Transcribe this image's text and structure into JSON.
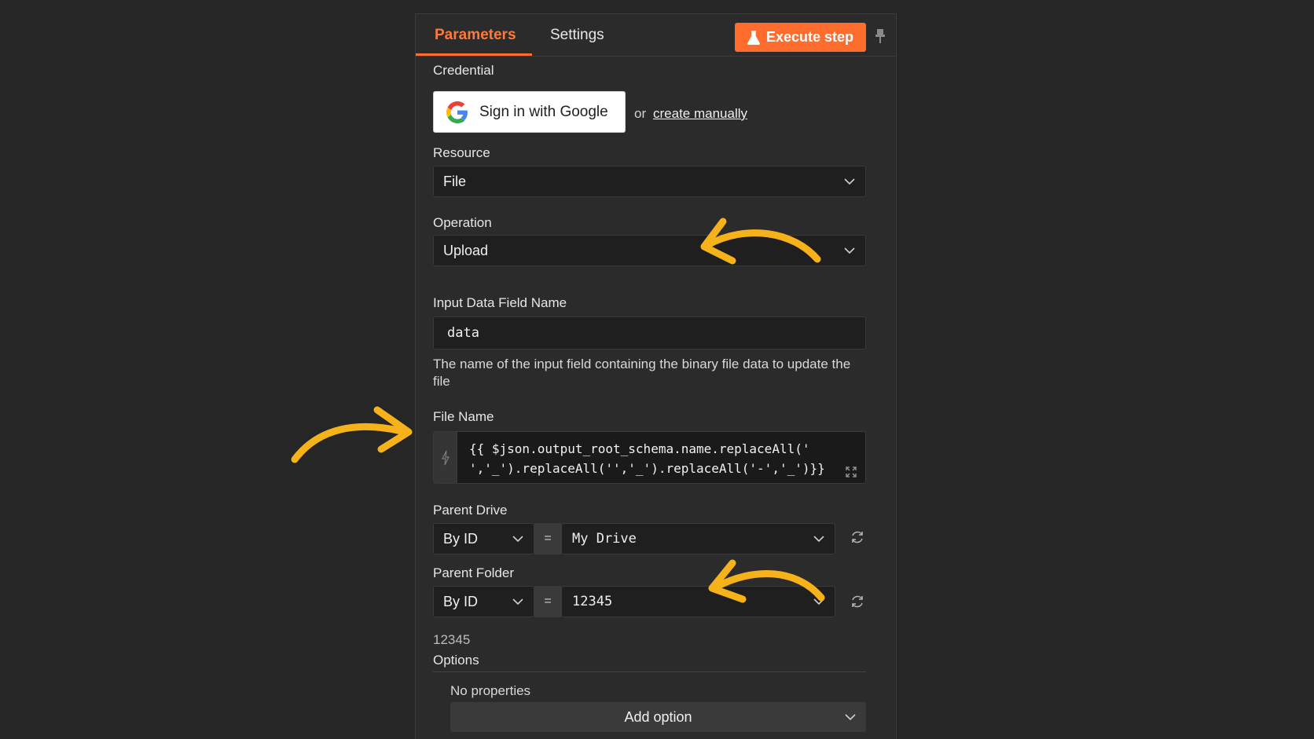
{
  "tabs": [
    {
      "label": "Parameters",
      "active": true
    },
    {
      "label": "Settings",
      "active": false
    }
  ],
  "toolbar": {
    "execute_label": "Execute step"
  },
  "credential": {
    "label": "Credential",
    "google_button": "Sign in with Google",
    "or_text": "or",
    "create_link": "create manually"
  },
  "resource": {
    "label": "Resource",
    "value": "File"
  },
  "operation": {
    "label": "Operation",
    "value": "Upload"
  },
  "input_field": {
    "label": "Input Data Field Name",
    "value": "data",
    "hint": "The name of the input field containing the binary file data to update the file"
  },
  "file_name": {
    "label": "File Name",
    "line1": "{{ $json.output_root_schema.name.replaceAll('",
    "line2": "','_').replaceAll('','_').replaceAll('-','_')}}"
  },
  "parent_drive": {
    "label": "Parent Drive",
    "mode": "By ID",
    "eq": "=",
    "value": "My Drive"
  },
  "parent_folder": {
    "label": "Parent Folder",
    "mode": "By ID",
    "eq": "=",
    "value": "12345",
    "hint": "12345"
  },
  "options": {
    "label": "Options",
    "empty_text": "No properties",
    "add_label": "Add option"
  },
  "colors": {
    "accent": "#ff6d2e",
    "arrow": "#f5b21a",
    "background": "#262626"
  },
  "icons": [
    "flask-icon",
    "pin-icon",
    "google-logo-icon",
    "chevron-down-icon",
    "bolt-icon",
    "expand-icon",
    "refresh-icon",
    "arrow-annotation"
  ]
}
